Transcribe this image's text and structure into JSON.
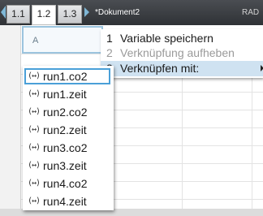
{
  "tabs": [
    {
      "label": "1.1",
      "active": false
    },
    {
      "label": "1.2",
      "active": true
    },
    {
      "label": "1.3",
      "active": false
    }
  ],
  "document_title": "*Dokument2",
  "mode_label": "RAD",
  "sheet": {
    "column_letter": "A",
    "selected_column_color": "#9bc4de"
  },
  "context_menu": {
    "items": [
      {
        "num": "1",
        "label": "Variable speichern",
        "enabled": true,
        "highlighted": false
      },
      {
        "num": "2",
        "label": "Verknüpfung aufheben",
        "enabled": false,
        "highlighted": false
      },
      {
        "num": "3",
        "label": "Verknüpfen mit:",
        "enabled": true,
        "highlighted": true,
        "has_submenu": true
      }
    ]
  },
  "variable_list": {
    "icon_glyph": "(↔)",
    "items": [
      {
        "label": "run1.co2",
        "selected": true
      },
      {
        "label": "run1.zeit",
        "selected": false
      },
      {
        "label": "run2.co2",
        "selected": false
      },
      {
        "label": "run2.zeit",
        "selected": false
      },
      {
        "label": "run3.co2",
        "selected": false
      },
      {
        "label": "run3.zeit",
        "selected": false
      },
      {
        "label": "run4.co2",
        "selected": false
      },
      {
        "label": "run4.zeit",
        "selected": false
      }
    ]
  },
  "colors": {
    "tabbar_bg": "#3a3d41",
    "selection_border": "#4aa0d8",
    "menu_highlight": "#cfe2f1",
    "disabled_text": "#9a9a9a"
  }
}
